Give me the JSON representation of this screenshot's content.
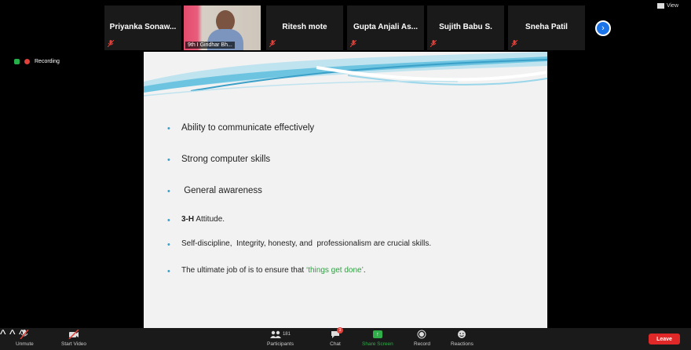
{
  "participants": [
    {
      "name": "Priyanka Sonaw..."
    },
    {
      "video_label": "9th I Giridhar Bh..."
    },
    {
      "name": "Ritesh mote"
    },
    {
      "name": "Gupta Anjali As..."
    },
    {
      "name": "Sujith Babu S."
    },
    {
      "name": "Sneha Patil"
    }
  ],
  "top": {
    "view_label": "View"
  },
  "recording": {
    "label": "Recording"
  },
  "slide": {
    "bullets": [
      "Ability to communicate effectively",
      "Strong computer skills",
      " General awareness",
      {
        "bold": "3-H",
        "rest": " Attitude."
      },
      "Self-discipline,  Integrity, honesty, and  professionalism are crucial skills.",
      {
        "pre": "The ultimate job of is to ensure that ",
        "green": "‘things get done’",
        "post": "."
      }
    ]
  },
  "toolbar": {
    "unmute": "Unmute",
    "start_video": "Start Video",
    "participants_count": "181",
    "participants": "Participants",
    "chat": "Chat",
    "chat_badge": "3",
    "share_screen": "Share Screen",
    "record": "Record",
    "reactions": "Reactions",
    "leave": "Leave"
  },
  "colors": {
    "accent": "#1a73e8",
    "leave": "#e02828",
    "share": "#2fae4a",
    "slide_bullet": "#3aa0c8",
    "highlight_text": "#2fa042"
  }
}
